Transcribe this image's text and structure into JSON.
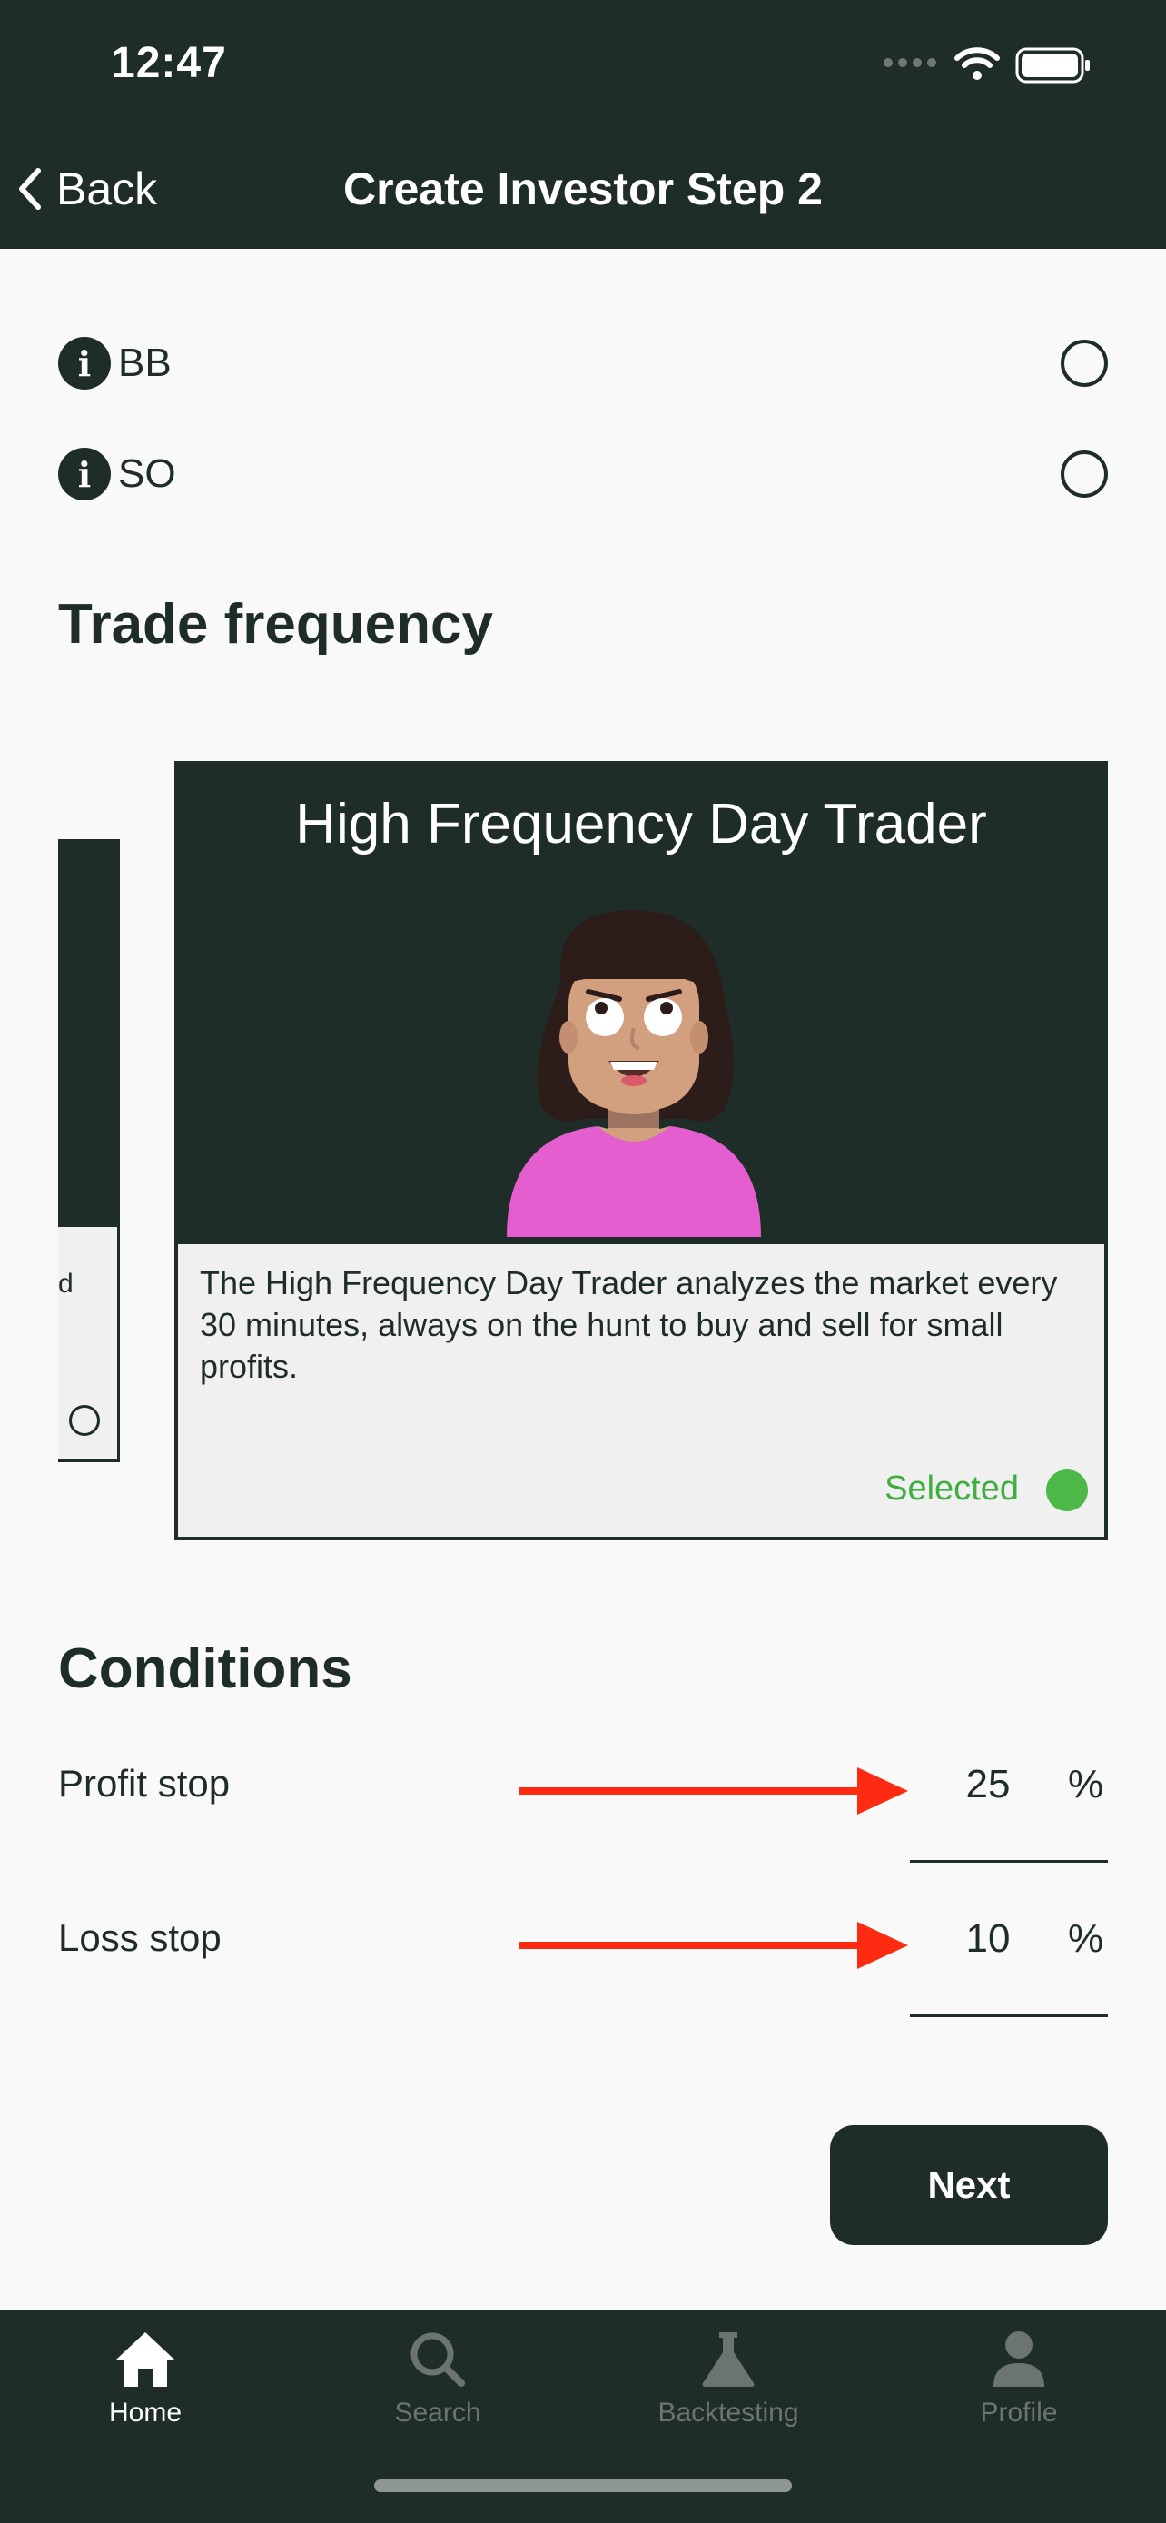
{
  "status_bar": {
    "time": "12:47"
  },
  "nav": {
    "back_label": "Back",
    "title": "Create Investor Step 2"
  },
  "options": [
    {
      "label": "BB",
      "selected": false
    },
    {
      "label": "SO",
      "selected": false
    }
  ],
  "trade_frequency": {
    "section_title": "Trade frequency",
    "prev_card_fragment": "d",
    "card": {
      "title": "High Frequency Day Trader",
      "description": "The High Frequency Day Trader analyzes the market every 30 minutes, always on the hunt to buy and sell for small profits.",
      "selected_label": "Selected"
    }
  },
  "conditions": {
    "section_title": "Conditions",
    "profit_stop": {
      "label": "Profit stop",
      "value": "25",
      "unit": "%"
    },
    "loss_stop": {
      "label": "Loss stop",
      "value": "10",
      "unit": "%"
    }
  },
  "next_button": "Next",
  "tabs": [
    {
      "label": "Home",
      "icon": "home-icon",
      "active": true
    },
    {
      "label": "Search",
      "icon": "search-icon",
      "active": false
    },
    {
      "label": "Backtesting",
      "icon": "flask-icon",
      "active": false
    },
    {
      "label": "Profile",
      "icon": "person-icon",
      "active": false
    }
  ],
  "colors": {
    "primary": "#1f2d28",
    "selected": "#4cb848",
    "arrow": "#ff2a12",
    "shirt": "#e55ed0",
    "tab_inactive": "#6c7471"
  }
}
